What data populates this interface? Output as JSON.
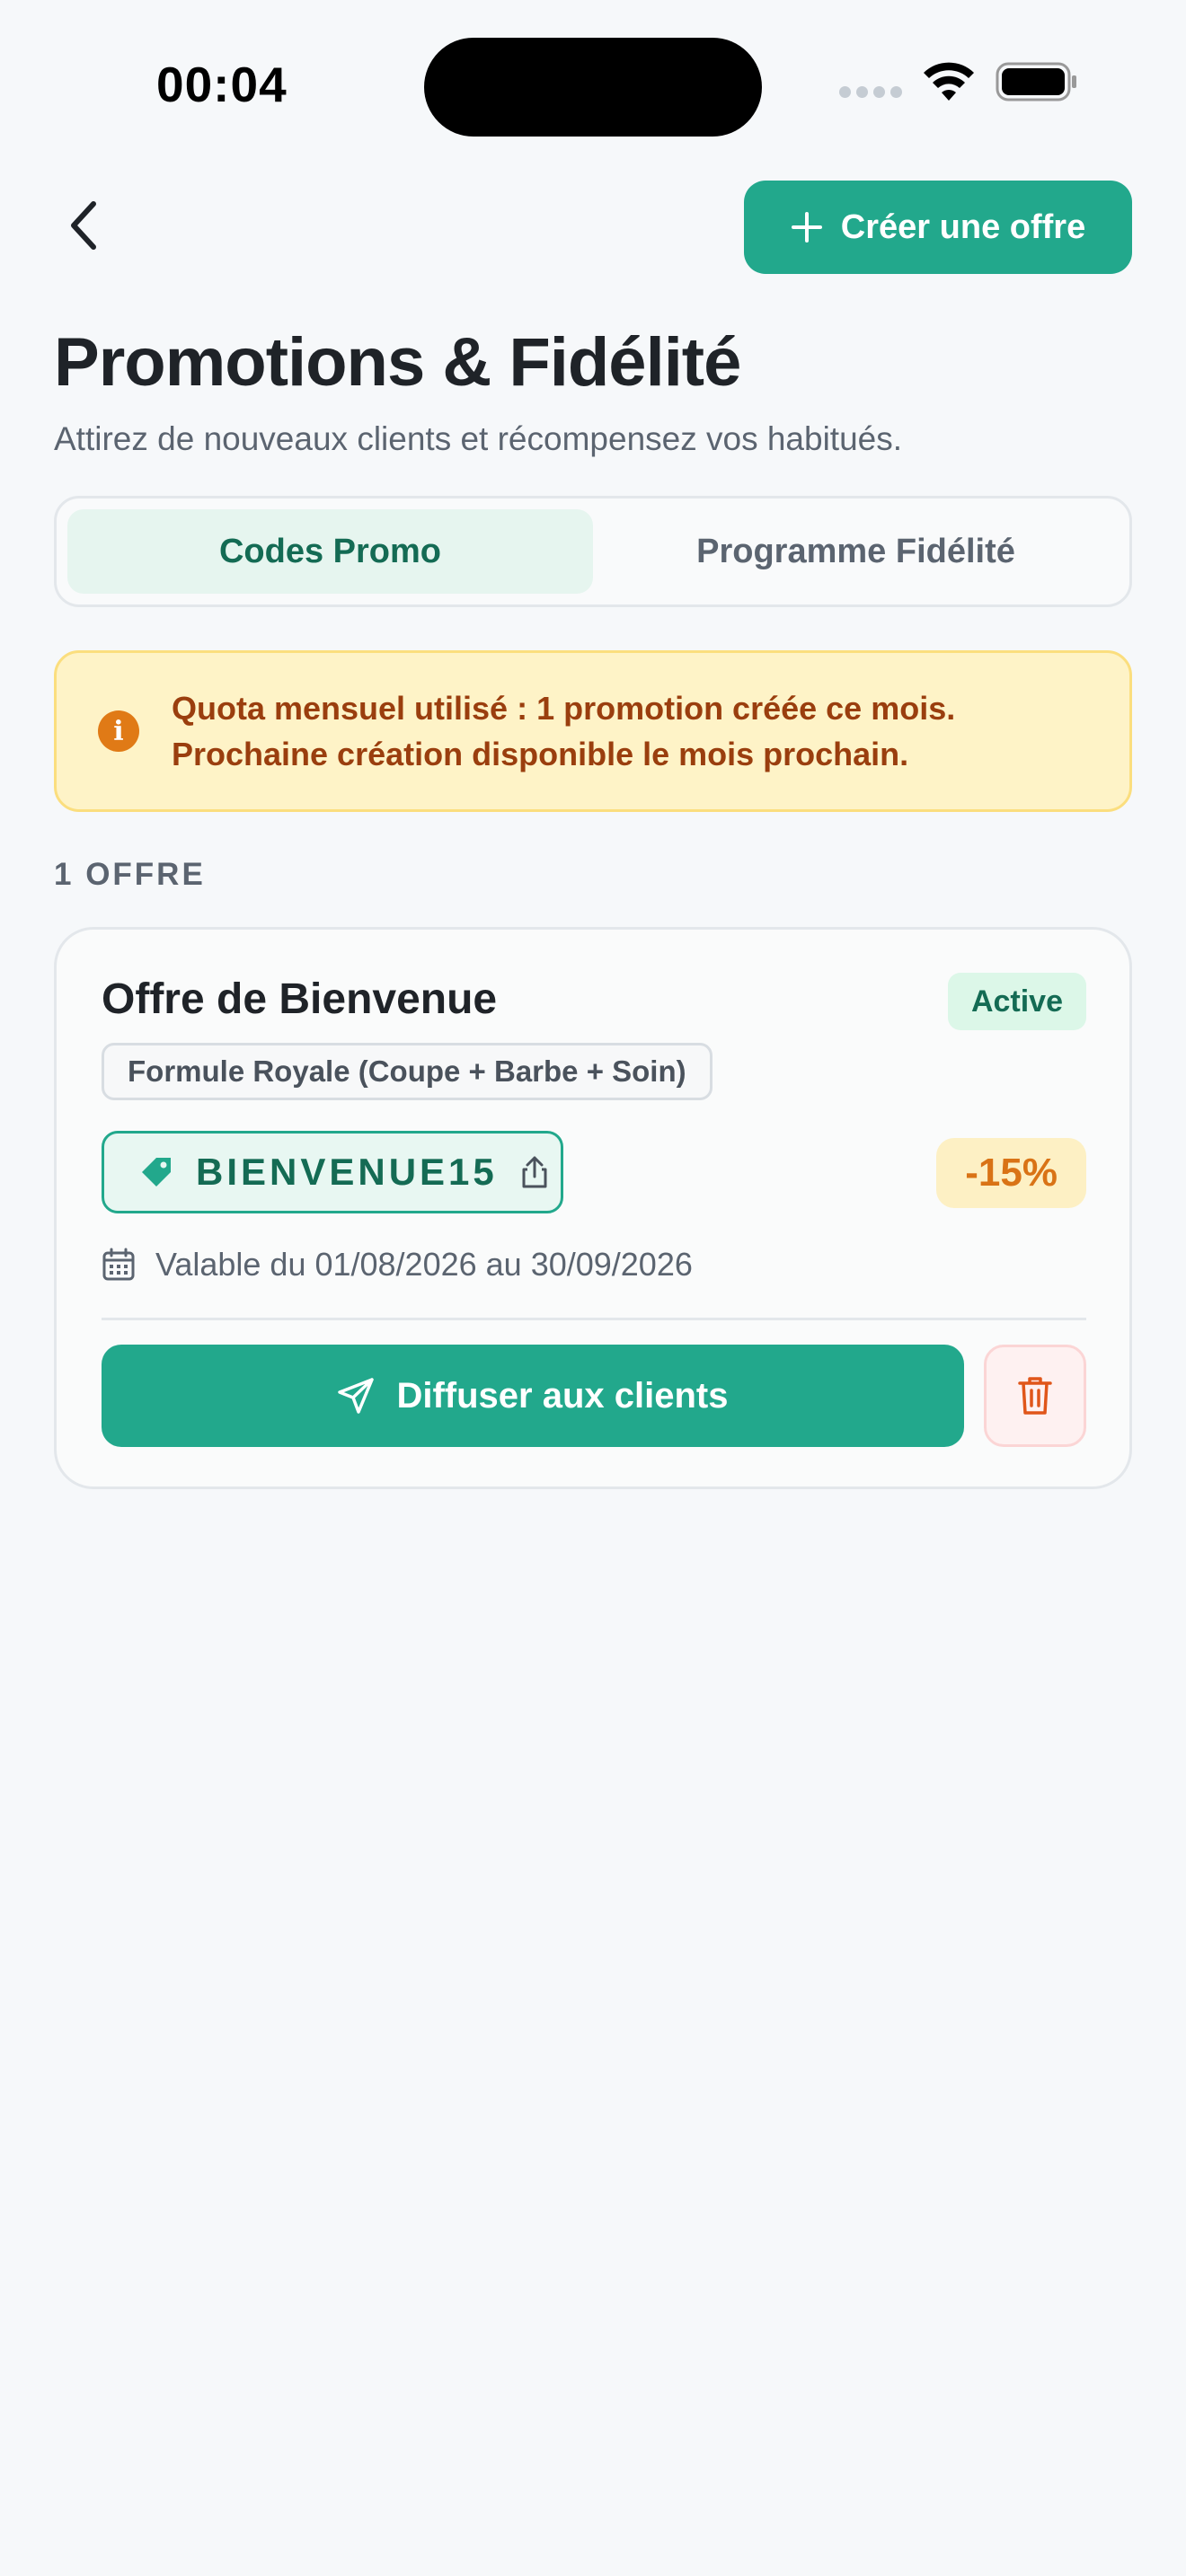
{
  "status_bar": {
    "time": "00:04"
  },
  "header": {
    "back_icon": "chevron-left-icon",
    "create_button_label": "Créer une offre",
    "title": "Promotions & Fidélité",
    "subtitle": "Attirez de nouveaux clients et récompensez vos habitués."
  },
  "tabs": [
    {
      "label": "Codes Promo",
      "active": true
    },
    {
      "label": "Programme Fidélité",
      "active": false
    }
  ],
  "quota_alert": {
    "line1": "Quota mensuel utilisé : 1 promotion créée ce mois.",
    "line2": "Prochaine création disponible le mois prochain."
  },
  "offers_count": "1 OFFRE",
  "offer": {
    "title": "Offre de Bienvenue",
    "status": "Active",
    "service": "Formule Royale (Coupe + Barbe + Soin)",
    "code": "BIENVENUE15",
    "discount": "-15%",
    "validity": "Valable du 01/08/2026 au 30/09/2026",
    "broadcast_label": "Diffuser aux clients"
  },
  "colors": {
    "primary": "#22A88C",
    "primary_dark": "#146B54",
    "warning_bg": "#FEF3C7",
    "warning_text": "#9A3E0E",
    "discount": "#D97316",
    "danger": "#E0561A"
  }
}
